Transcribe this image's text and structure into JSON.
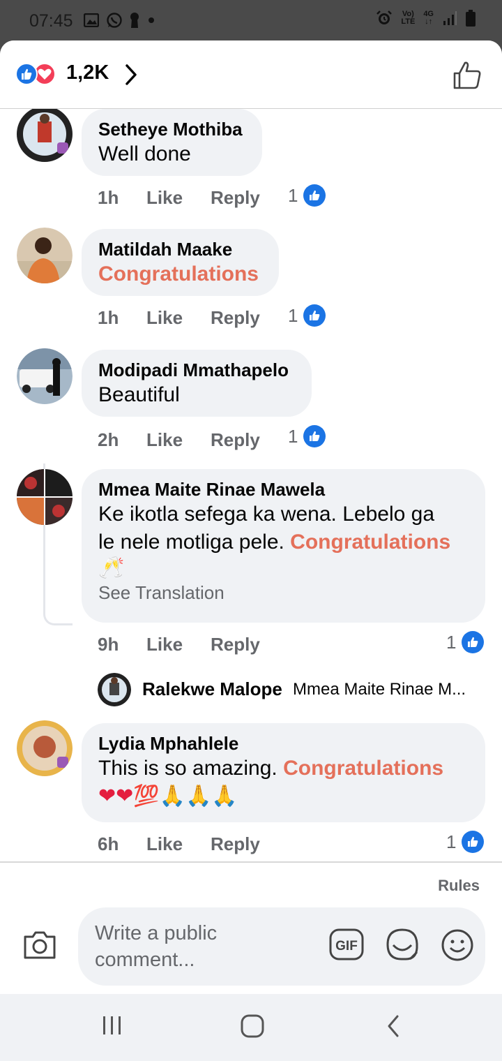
{
  "status_bar": {
    "time": "07:45",
    "left_icons": [
      "gallery-icon",
      "whatsapp-icon",
      "keyhole-icon",
      "dot-icon"
    ],
    "right_icons": [
      "alarm-icon",
      "volte-icon",
      "network-4g-icon",
      "signal-icon",
      "battery-icon"
    ],
    "volte_top": "Vo)",
    "volte_bottom": "LTE",
    "net_label": "4G"
  },
  "reactions": {
    "count": "1,2K",
    "icons": [
      "like-reaction-icon",
      "love-reaction-icon"
    ]
  },
  "comments": [
    {
      "name": "Setheye Mothiba",
      "segments": [
        {
          "text": "Well done",
          "hl": false
        }
      ],
      "time": "1h",
      "like_label": "Like",
      "reply_label": "Reply",
      "reaction_count": "1"
    },
    {
      "name": "Matildah Maake",
      "segments": [
        {
          "text": "Congratulations",
          "hl": true
        }
      ],
      "time": "1h",
      "like_label": "Like",
      "reply_label": "Reply",
      "reaction_count": "1"
    },
    {
      "name": "Modipadi Mmathapelo",
      "segments": [
        {
          "text": "Beautiful",
          "hl": false
        }
      ],
      "time": "2h",
      "like_label": "Like",
      "reply_label": "Reply",
      "reaction_count": "1"
    },
    {
      "name": "Mmea Maite Rinae Mawela",
      "line1": "Ke ikotla sefega ka wena. Lebelo ga",
      "line2_plain": "le nele motliga pele. ",
      "line2_hl": "Congratulations",
      "line3_emoji": "🥂",
      "see_translation": "See Translation",
      "time": "9h",
      "like_label": "Like",
      "reply_label": "Reply",
      "reaction_count": "1",
      "reply_preview": {
        "name": "Ralekwe Malope",
        "text": "Mmea Maite Rinae M..."
      }
    },
    {
      "name": "Lydia Mphahlele",
      "line1_plain": "This is so amazing. ",
      "line1_hl": "Congratulations",
      "line2_emoji": "❤❤💯🙏🙏🙏",
      "time": "6h",
      "like_label": "Like",
      "reply_label": "Reply",
      "reaction_count": "1"
    }
  ],
  "footer": {
    "rules_label": "Rules",
    "input_placeholder": "Write a public comment...",
    "gif_label": "GIF"
  },
  "nav": [
    "recent-apps-icon",
    "home-icon",
    "back-icon"
  ]
}
